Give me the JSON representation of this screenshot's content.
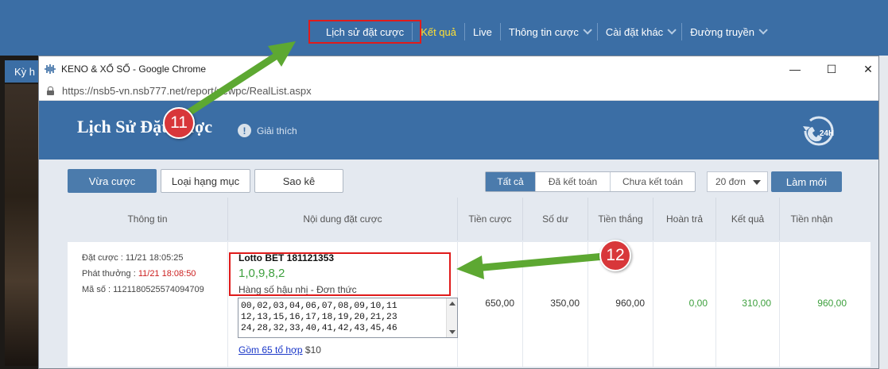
{
  "top_nav": {
    "items": [
      {
        "label": "Lịch sử đặt cược",
        "dropdown": false,
        "highlight": false
      },
      {
        "label": "Kết quả",
        "dropdown": false,
        "highlight": true
      },
      {
        "label": "Live",
        "dropdown": false,
        "highlight": false
      },
      {
        "label": "Thông tin cược",
        "dropdown": true,
        "highlight": false
      },
      {
        "label": "Cài đặt khác",
        "dropdown": true,
        "highlight": false
      },
      {
        "label": "Đường truyền",
        "dropdown": true,
        "highlight": false
      }
    ]
  },
  "background": {
    "left_tab_label": "Kỳ h"
  },
  "window": {
    "title": "KENO & XỔ SỐ - Google Chrome",
    "url": "https://nsb5-vn.nsb777.net/report/newpc/RealList.aspx",
    "min_label": "—",
    "max_label": "☐",
    "close_label": "✕"
  },
  "header": {
    "title": "Lịch Sử Đặt Cược",
    "info_icon": "!",
    "info_label": "Giải thích",
    "badge_label": "24H"
  },
  "toolbar": {
    "tabs": [
      "Vừa cược",
      "Loại hạng mục",
      "Sao kê"
    ],
    "filters": [
      "Tất cả",
      "Đã kết toán",
      "Chưa kết toán"
    ],
    "page_size": "20 đơn",
    "refresh_label": "Làm mới"
  },
  "table": {
    "headers": [
      "Thông tin",
      "Nội dung đặt cược",
      "Tiền cược",
      "Số dư",
      "Tiền thắng",
      "Hoàn trả",
      "Kết quả",
      "Tiền nhận"
    ],
    "row": {
      "bet_time_label": "Đặt cược : ",
      "bet_time": "11/21 18:05:25",
      "payout_time_label": "Phát thưởng : ",
      "payout_time": "11/21 18:08:50",
      "ticket_label": "Mã số : ",
      "ticket_no": "1121180525574094709",
      "bet_title": "Lotto BET 181121353",
      "bet_numbers": "1,0,9,8,2",
      "bet_type": "Hàng số hậu nhị - Đơn thức",
      "combo_lines": [
        "00,02,03,04,06,07,08,09,10,11",
        "12,13,15,16,17,18,19,20,21,23",
        "24,28,32,33,40,41,42,43,45,46"
      ],
      "combo_link": "Gồm 65 tổ hợp",
      "combo_price": " $10",
      "stake": "650,00",
      "balance": "350,00",
      "win": "960,00",
      "refund": "0,00",
      "result": "310,00",
      "received": "960,00"
    }
  },
  "annotations": {
    "step_11": "11",
    "step_12": "12"
  },
  "colors": {
    "brand_blue": "#3b6ea5",
    "highlight_red": "#e01b1b",
    "arrow_green": "#5da832",
    "positive_green": "#3ea03e"
  }
}
